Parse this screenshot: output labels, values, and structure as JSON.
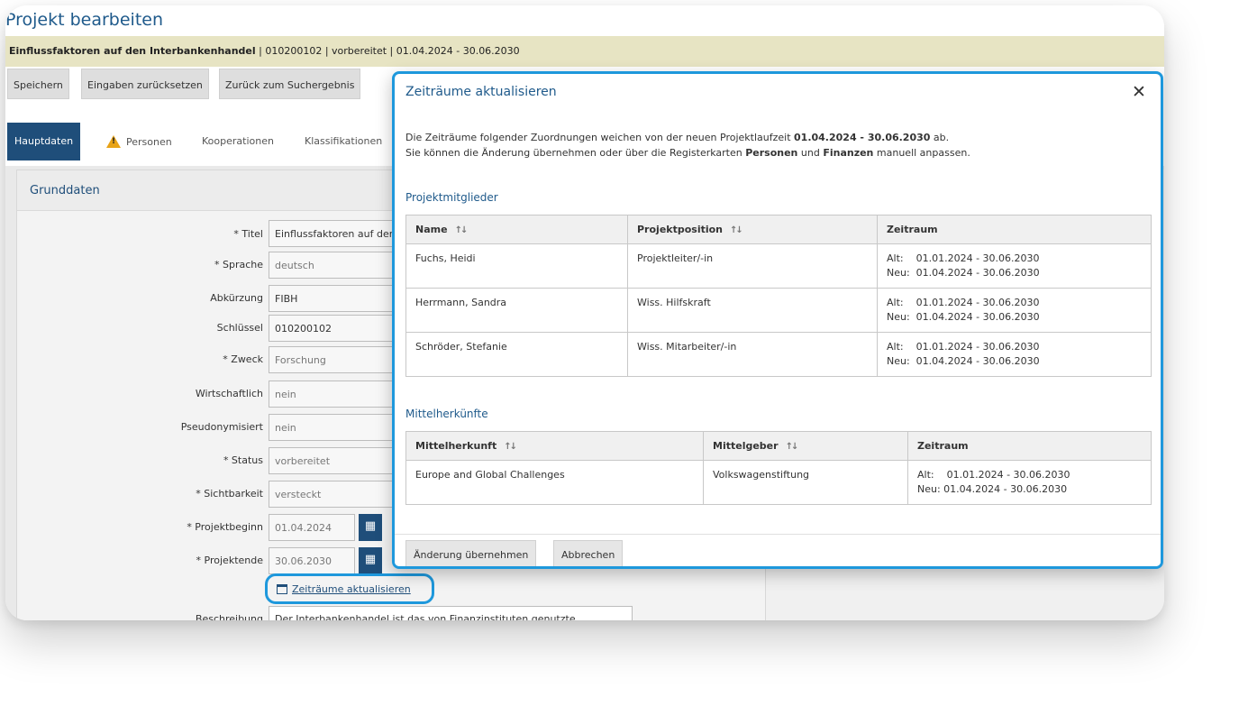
{
  "page": {
    "title": "Projekt bearbeiten",
    "context_bold": "Einflussfaktoren auf den Interbankenhandel",
    "context_rest": " | 010200102 | vorbereitet | 01.04.2024 - 30.06.2030"
  },
  "toolbar": {
    "save": "Speichern",
    "reset": "Eingaben zurücksetzen",
    "back": "Zurück zum Suchergebnis"
  },
  "tabs": [
    "Hauptdaten",
    "Personen",
    "Kooperationen",
    "Klassifikationen"
  ],
  "panel": {
    "title": "Grunddaten",
    "fields": [
      {
        "label": "* Titel",
        "value": "Einflussfaktoren auf den"
      },
      {
        "label": "* Sprache",
        "value": "deutsch"
      },
      {
        "label": "Abkürzung",
        "value": "FIBH"
      },
      {
        "label": "Schlüssel",
        "value": "010200102"
      },
      {
        "label": "* Zweck",
        "value": "Forschung"
      },
      {
        "label": "Wirtschaftlich",
        "value": "nein"
      },
      {
        "label": "Pseudonymisiert",
        "value": "nein"
      },
      {
        "label": "* Status",
        "value": "vorbereitet"
      },
      {
        "label": "* Sichtbarkeit",
        "value": "versteckt"
      },
      {
        "label": "* Projektbeginn",
        "value": "01.04.2024"
      },
      {
        "label": "* Projektende",
        "value": "30.06.2030"
      }
    ],
    "update_link": "Zeiträume aktualisieren",
    "description_label": "Beschreibung",
    "description_value": "Der Interbankenhandel ist das von Finanzinstituten genutzte"
  },
  "dialog": {
    "title": "Zeiträume aktualisieren",
    "close": "✕",
    "intro_1_a": "Die Zeiträume folgender Zuordnungen weichen von der neuen Projektlaufzeit ",
    "intro_1_b": "01.04.2024 - 30.06.2030",
    "intro_1_c": " ab.",
    "intro_2_a": "Sie können die Änderung übernehmen oder über die Registerkarten ",
    "intro_2_b": "Personen",
    "intro_2_c": " und ",
    "intro_2_d": "Finanzen",
    "intro_2_e": " manuell anpassen.",
    "members": {
      "heading": "Projektmitglieder",
      "columns": [
        "Name",
        "Projektposition",
        "Zeitraum"
      ],
      "rows": [
        {
          "name": "Fuchs, Heidi",
          "position": "Projektleiter/-in",
          "alt": "Alt:    01.01.2024 - 30.06.2030",
          "neu": "Neu:  01.04.2024 - 30.06.2030"
        },
        {
          "name": "Herrmann, Sandra",
          "position": "Wiss. Hilfskraft",
          "alt": "Alt:    01.01.2024 - 30.06.2030",
          "neu": "Neu:  01.04.2024 - 30.06.2030"
        },
        {
          "name": "Schröder, Stefanie",
          "position": "Wiss. Mitarbeiter/-in",
          "alt": "Alt:    01.01.2024 - 30.06.2030",
          "neu": "Neu:  01.04.2024 - 30.06.2030"
        }
      ]
    },
    "funding": {
      "heading": "Mittelherkünfte",
      "columns": [
        "Mittelherkunft",
        "Mittelgeber",
        "Zeitraum"
      ],
      "rows": [
        {
          "source": "Europe and Global Challenges",
          "funder": "Volkswagenstiftung",
          "alt": "Alt:    01.01.2024 - 30.06.2030",
          "neu": "Neu: 01.04.2024 - 30.06.2030"
        }
      ]
    },
    "apply": "Änderung übernehmen",
    "cancel": "Abbrechen"
  },
  "colors": {
    "accent": "#1f5a8b",
    "highlight_border": "#1e98dc",
    "tab_active": "#1f4e7a",
    "context_bar": "#e7e4c3"
  }
}
